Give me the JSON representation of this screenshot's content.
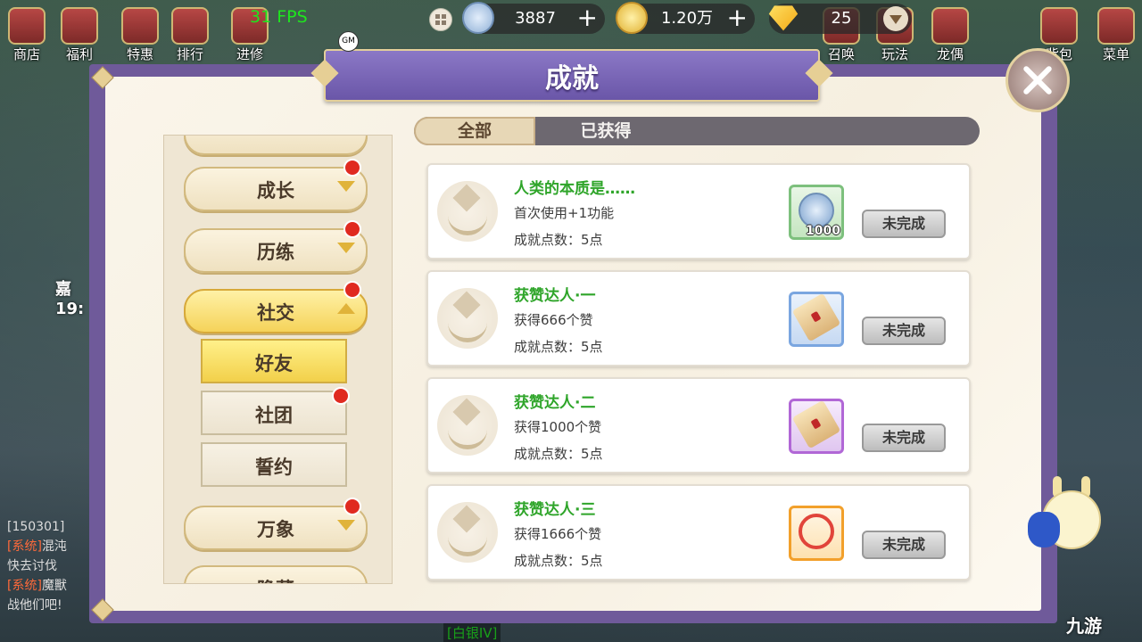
{
  "fps": "31 FPS",
  "top_menu": [
    "商店",
    "福利",
    "特惠",
    "排行",
    "进修"
  ],
  "top_menu_right": [
    "召唤",
    "玩法",
    "龙偶",
    "背包",
    "菜单"
  ],
  "currencies": {
    "silver": "3887",
    "gold": "1.20万",
    "diamond": "25"
  },
  "gm_badge": "GM",
  "title": "成就",
  "tabs": {
    "all": "全部",
    "obtained": "已获得"
  },
  "categories": {
    "growth": "成长",
    "training": "历练",
    "social": "社交",
    "friends": "好友",
    "guild": "社团",
    "oath": "誓约",
    "myriad": "万象",
    "hidden": "隐藏"
  },
  "achievements": [
    {
      "name": "人类的本质是……",
      "desc": "首次使用+1功能",
      "points": "成就点数：5点",
      "reward_qty": "1000",
      "status": "未完成"
    },
    {
      "name": "获赞达人·一",
      "desc": "获得666个赞",
      "points": "成就点数：5点",
      "reward_qty": "",
      "status": "未完成"
    },
    {
      "name": "获赞达人·二",
      "desc": "获得1000个赞",
      "points": "成就点数：5点",
      "reward_qty": "",
      "status": "未完成"
    },
    {
      "name": "获赞达人·三",
      "desc": "获得1666个赞",
      "points": "成就点数：5点",
      "reward_qty": "",
      "status": "未完成"
    }
  ],
  "chat": {
    "line1": "[150301]",
    "line2_tag": "[系统]",
    "line2": "混沌",
    "line3": "快去讨伐",
    "line4_tag": "[系统]",
    "line4": "魔獸",
    "line5": "战他们吧!"
  },
  "side_clock_top": "嘉",
  "side_clock": "19:",
  "rank_badge": "[白银IV]",
  "watermark": "九游",
  "colors": {
    "accent_purple": "#6f5a9a",
    "name_green": "#2fa52a",
    "red_dot": "#e02a20"
  }
}
